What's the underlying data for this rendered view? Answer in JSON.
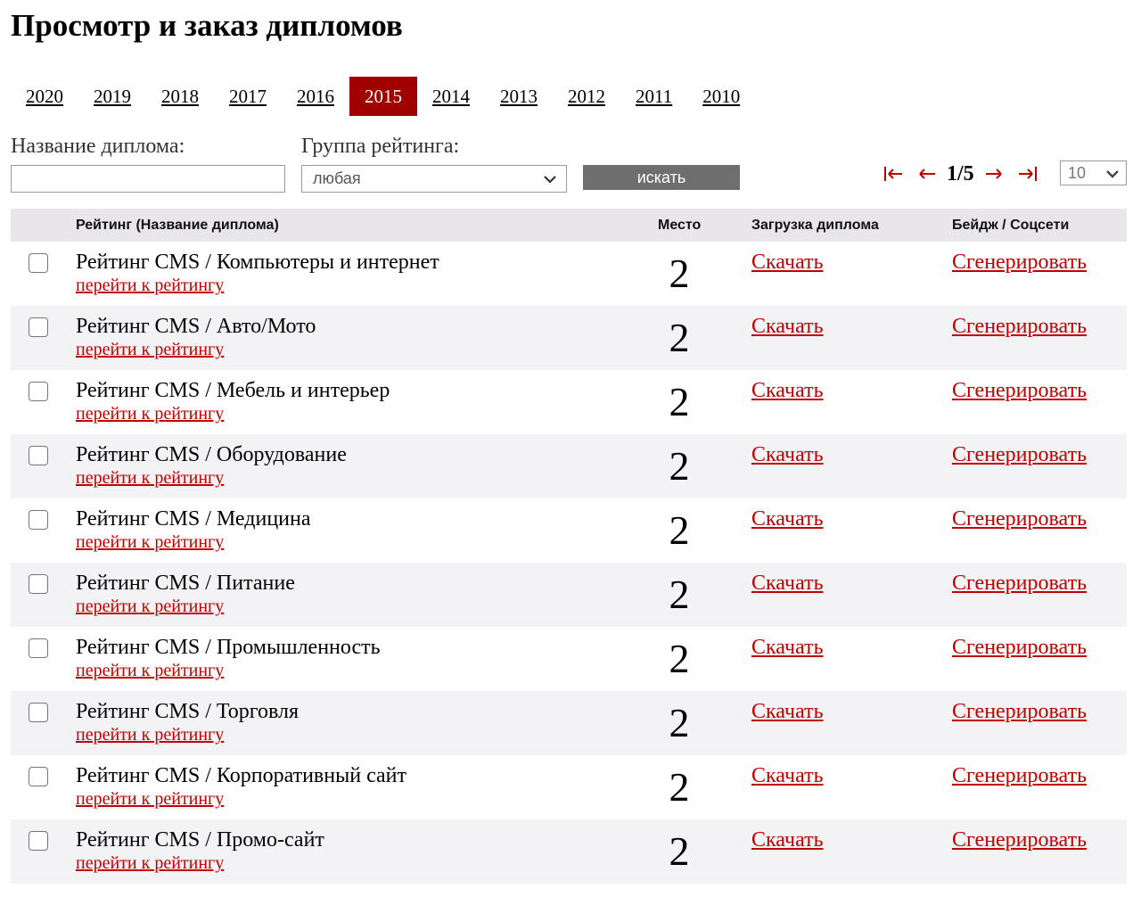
{
  "page_title": "Просмотр и заказ дипломов",
  "years": [
    "2020",
    "2019",
    "2018",
    "2017",
    "2016",
    "2015",
    "2014",
    "2013",
    "2012",
    "2011",
    "2010"
  ],
  "active_year": "2015",
  "filters": {
    "name_label": "Название диплома:",
    "name_value": "",
    "group_label": "Группа рейтинга:",
    "group_value": "любая",
    "search_label": "искать"
  },
  "pagination": {
    "current": "1/5",
    "per_page": "10"
  },
  "table": {
    "headers": {
      "rating": "Рейтинг (Название диплома)",
      "place": "Место",
      "download": "Загрузка диплома",
      "badge": "Бейдж / Соцсети"
    },
    "rows": [
      {
        "title": "Рейтинг CMS / Компьютеры и интернет",
        "link": "перейти к рейтингу",
        "place": "2",
        "download": "Скачать",
        "generate": "Сгенерировать"
      },
      {
        "title": "Рейтинг CMS / Авто/Мото",
        "link": "перейти к рейтингу",
        "place": "2",
        "download": "Скачать",
        "generate": "Сгенерировать"
      },
      {
        "title": "Рейтинг CMS / Мебель и интерьер",
        "link": "перейти к рейтингу",
        "place": "2",
        "download": "Скачать",
        "generate": "Сгенерировать"
      },
      {
        "title": "Рейтинг CMS / Оборудование",
        "link": "перейти к рейтингу",
        "place": "2",
        "download": "Скачать",
        "generate": "Сгенерировать"
      },
      {
        "title": "Рейтинг CMS / Медицина",
        "link": "перейти к рейтингу",
        "place": "2",
        "download": "Скачать",
        "generate": "Сгенерировать"
      },
      {
        "title": "Рейтинг CMS / Питание",
        "link": "перейти к рейтингу",
        "place": "2",
        "download": "Скачать",
        "generate": "Сгенерировать"
      },
      {
        "title": "Рейтинг CMS / Промышленность",
        "link": "перейти к рейтингу",
        "place": "2",
        "download": "Скачать",
        "generate": "Сгенерировать"
      },
      {
        "title": "Рейтинг CMS / Торговля",
        "link": "перейти к рейтингу",
        "place": "2",
        "download": "Скачать",
        "generate": "Сгенерировать"
      },
      {
        "title": "Рейтинг CMS / Корпоративный сайт",
        "link": "перейти к рейтингу",
        "place": "2",
        "download": "Скачать",
        "generate": "Сгенерировать"
      },
      {
        "title": "Рейтинг CMS / Промо-сайт",
        "link": "перейти к рейтингу",
        "place": "2",
        "download": "Скачать",
        "generate": "Сгенерировать"
      }
    ]
  },
  "colors": {
    "accent": "#a00000",
    "link": "#c00000",
    "header_bg": "#e8e6e8",
    "row_alt": "#f3f3f5",
    "button_bg": "#6e6e6e"
  },
  "icons": {
    "first": "first-page-icon",
    "prev": "prev-page-icon",
    "next": "next-page-icon",
    "last": "last-page-icon",
    "dropdown": "chevron-down-icon"
  }
}
